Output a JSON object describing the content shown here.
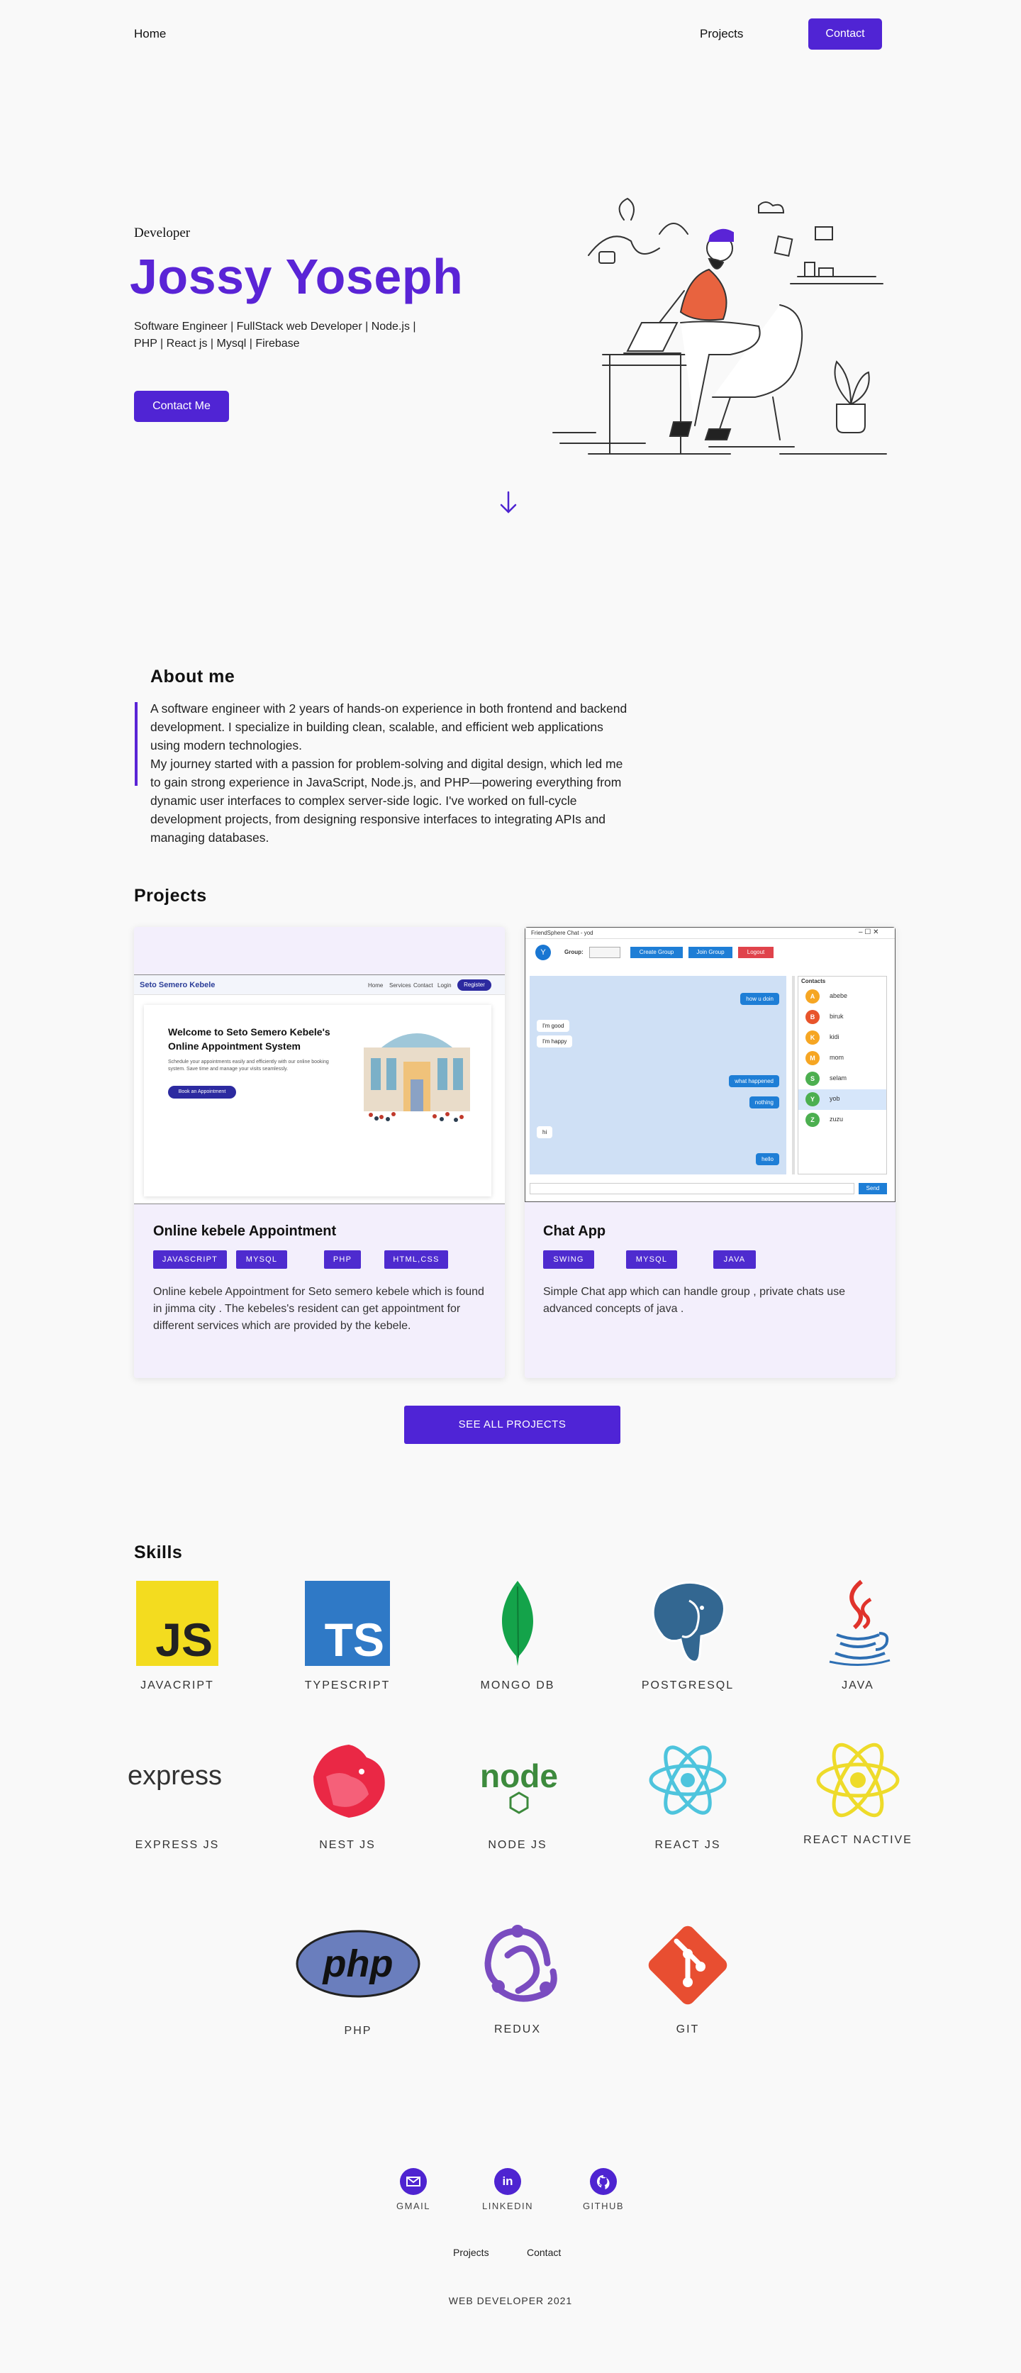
{
  "nav": {
    "home": "Home",
    "projects": "Projects",
    "contact": "Contact"
  },
  "hero": {
    "role": "Developer",
    "name": "Jossy Yoseph",
    "subtitle_line1": "Software Engineer | FullStack web Developer | Node.js |",
    "subtitle_line2": "PHP | React js | Mysql | Firebase",
    "cta": "Contact Me",
    "scroll_icon": "arrow-down-icon"
  },
  "about": {
    "title": "About me",
    "text": " A software engineer with 2 years of hands-on experience in both frontend and backend\ndevelopment. I specialize in building clean, scalable, and efficient web applications\nusing modern technologies.\nMy journey started with a passion for problem-solving and digital design, which led me\nto gain strong experience in JavaScript, Node.js, and PHP—powering everything from\ndynamic user interfaces to complex server-side logic. I've worked on full-cycle\ndevelopment projects, from designing responsive interfaces to integrating APIs and\nmanaging databases."
  },
  "projects": {
    "title": "Projects",
    "items": [
      {
        "title": "Online kebele Appointment",
        "tags": [
          "JAVASCRIPT",
          "MYSQL",
          "PHP",
          "HTML,CSS"
        ],
        "desc": "Online kebele Appointment for Seto semero kebele which is found in jimma city .  The kebeles's resident can get appointment for different services which are provided by the kebele.",
        "shot": {
          "brand": "Seto Semero Kebele",
          "links": [
            "Home",
            "Services",
            "Contact",
            "Login"
          ],
          "register": "Register",
          "heading_line1": "Welcome to Seto Semero Kebele's",
          "heading_line2": "Online Appointment System",
          "body_line1": "Schedule your appointments easily and efficiently with our online booking",
          "body_line2": "system. Save time and manage your visits seamlessly.",
          "cta": "Book an Appointment"
        }
      },
      {
        "title": "Chat App",
        "tags": [
          "SWING",
          "MYSQL",
          "JAVA"
        ],
        "desc": "Simple Chat app which can handle group , private chats use advanced concepts of java .",
        "shot": {
          "window_title": "FriendSphere Chat - yod",
          "avatar": "Y",
          "group_label": "Group:",
          "buttons": [
            "Create Group",
            "Join Group",
            "Logout"
          ],
          "contacts_title": "Contacts",
          "contacts": [
            {
              "initial": "A",
              "name": "abebe",
              "color": "#f6a623"
            },
            {
              "initial": "B",
              "name": "biruk",
              "color": "#e8542b"
            },
            {
              "initial": "K",
              "name": "kidi",
              "color": "#f6a623"
            },
            {
              "initial": "M",
              "name": "mom",
              "color": "#f6a623"
            },
            {
              "initial": "S",
              "name": "selam",
              "color": "#4caf50"
            },
            {
              "initial": "Y",
              "name": "yob",
              "color": "#4caf50"
            },
            {
              "initial": "Z",
              "name": "zuzu",
              "color": "#4caf50"
            }
          ],
          "messages": [
            {
              "text": "how u doin",
              "side": "right"
            },
            {
              "text": "I'm good",
              "side": "left"
            },
            {
              "text": "I'm happy",
              "side": "left"
            },
            {
              "text": "what happened",
              "side": "right"
            },
            {
              "text": "nothing",
              "side": "right"
            },
            {
              "text": "hi",
              "side": "left"
            },
            {
              "text": "hello",
              "side": "right"
            }
          ],
          "send": "Send"
        }
      }
    ],
    "see_all": "SEE ALL PROJECTS"
  },
  "skills": {
    "title": "Skills",
    "items": [
      {
        "label": "JAVACRIPT",
        "icon": "javascript-icon"
      },
      {
        "label": "TYPESCRIPT",
        "icon": "typescript-icon"
      },
      {
        "label": "MONGO DB",
        "icon": "mongodb-icon"
      },
      {
        "label": "POSTGRESQL",
        "icon": "postgresql-icon"
      },
      {
        "label": "JAVA",
        "icon": "java-icon"
      },
      {
        "label": "EXPRESS JS",
        "icon": "express-icon"
      },
      {
        "label": "NEST JS",
        "icon": "nestjs-icon"
      },
      {
        "label": "NODE JS",
        "icon": "nodejs-icon"
      },
      {
        "label": "REACT JS",
        "icon": "react-icon"
      },
      {
        "label": "REACT NACTIVE",
        "icon": "react-native-icon"
      },
      {
        "label": "PHP",
        "icon": "php-icon"
      },
      {
        "label": "REDUX",
        "icon": "redux-icon"
      },
      {
        "label": "GIT",
        "icon": "git-icon"
      }
    ],
    "logo_text": {
      "js": "JS",
      "ts": "TS",
      "express": "express",
      "node": "node",
      "php": "php"
    }
  },
  "footer": {
    "social": [
      {
        "label": "GMAIL",
        "icon": "gmail-icon"
      },
      {
        "label": "LINKEDIN",
        "icon": "linkedin-icon"
      },
      {
        "label": "GITHUB",
        "icon": "github-icon"
      }
    ],
    "linkedin_glyph": "in",
    "links": [
      "Projects",
      "Contact"
    ],
    "copyright": "WEB DEVELOPER 2021"
  },
  "colors": {
    "accent": "#5a24d6",
    "background": "#f9f9f9",
    "card": "#f3effc"
  }
}
